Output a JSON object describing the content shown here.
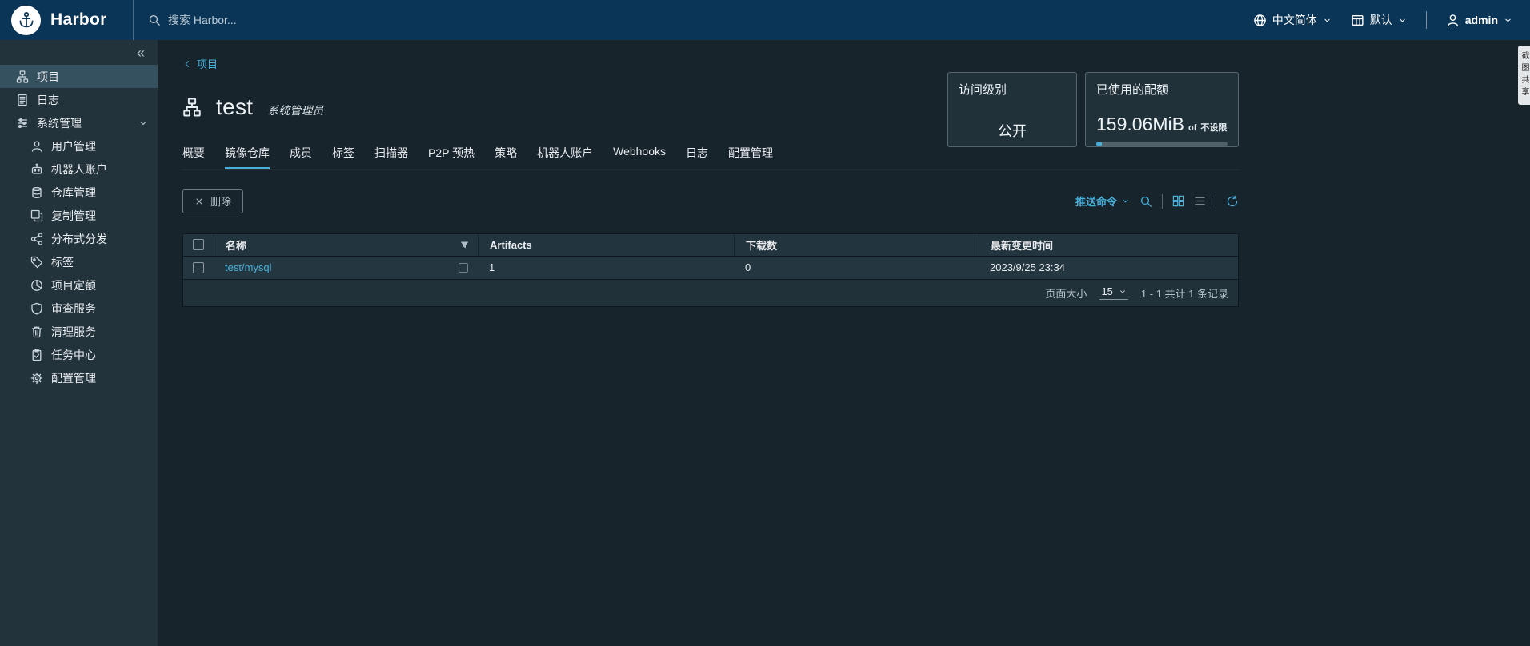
{
  "header": {
    "brand": "Harbor",
    "search_placeholder": "搜索 Harbor...",
    "language_label": "中文简体",
    "theme_label": "默认",
    "username": "admin"
  },
  "sidebar": {
    "collapse_icon": "«",
    "items": [
      {
        "label": "项目",
        "icon": "projects-icon",
        "active": true
      },
      {
        "label": "日志",
        "icon": "logs-icon",
        "active": false
      },
      {
        "label": "系统管理",
        "icon": "system-admin-icon",
        "active": false,
        "expanded": true
      },
      {
        "label": "用户管理",
        "icon": "users-icon",
        "active": false,
        "sub": true
      },
      {
        "label": "机器人账户",
        "icon": "robot-icon",
        "active": false,
        "sub": true
      },
      {
        "label": "仓库管理",
        "icon": "registry-icon",
        "active": false,
        "sub": true
      },
      {
        "label": "复制管理",
        "icon": "replication-icon",
        "active": false,
        "sub": true
      },
      {
        "label": "分布式分发",
        "icon": "distribution-icon",
        "active": false,
        "sub": true
      },
      {
        "label": "标签",
        "icon": "label-icon",
        "active": false,
        "sub": true
      },
      {
        "label": "项目定额",
        "icon": "quota-icon",
        "active": false,
        "sub": true
      },
      {
        "label": "审查服务",
        "icon": "shield-icon",
        "active": false,
        "sub": true
      },
      {
        "label": "清理服务",
        "icon": "trash-icon",
        "active": false,
        "sub": true
      },
      {
        "label": "任务中心",
        "icon": "tasks-icon",
        "active": false,
        "sub": true
      },
      {
        "label": "配置管理",
        "icon": "gear-icon",
        "active": false,
        "sub": true
      }
    ]
  },
  "main": {
    "breadcrumb_label": "项目",
    "project": {
      "name": "test",
      "role": "系统管理员"
    },
    "access_card": {
      "title": "访问级别",
      "value": "公开"
    },
    "quota_card": {
      "title": "已使用的配额",
      "used": "159.06MiB",
      "of_label": "of",
      "limit": "不设限"
    },
    "tabs": [
      "概要",
      "镜像仓库",
      "成员",
      "标签",
      "扫描器",
      "P2P 预热",
      "策略",
      "机器人账户",
      "Webhooks",
      "日志",
      "配置管理"
    ],
    "active_tab": "镜像仓库",
    "toolbar": {
      "delete_label": "删除",
      "push_command_label": "推送命令"
    },
    "table": {
      "headers": [
        "名称",
        "Artifacts",
        "下载数",
        "最新变更时间"
      ],
      "rows": [
        {
          "name": "test/mysql",
          "artifacts": "1",
          "pulls": "0",
          "updated": "2023/9/25 23:34"
        }
      ]
    },
    "pagination": {
      "page_size_label": "页面大小",
      "page_size": "15",
      "range_summary": "1 - 1 共计 1 条记录"
    }
  },
  "side_tab": {
    "text": "截图共享"
  },
  "colors": {
    "accent_blue": "#49afd9",
    "header_bg": "#0b3556",
    "sidebar_active_bg": "#35505f",
    "content_bg": "#17242b"
  }
}
